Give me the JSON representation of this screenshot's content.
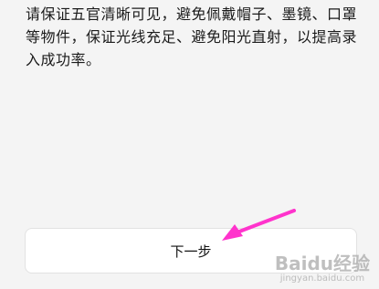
{
  "instructions": {
    "text": "请保证五官清晰可见，避免佩戴帽子、墨镜、口罩等物件，保证光线充足、避免阳光直射，以提高录入成功率。"
  },
  "next_button": {
    "label": "下一步"
  },
  "annotation": {
    "arrow_color": "#ff33cc"
  },
  "watermark": {
    "brand": "Baidu经验",
    "url": "jingyan.baidu.com"
  }
}
